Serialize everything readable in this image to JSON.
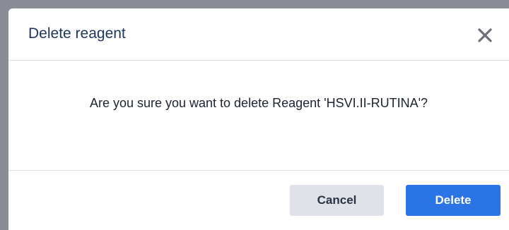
{
  "dialog": {
    "title": "Delete reagent",
    "message": "Are you sure you want to delete Reagent 'HSVI.II-RUTINA'?",
    "close_icon": "close-icon",
    "cancel_label": "Cancel",
    "delete_label": "Delete"
  },
  "colors": {
    "primary": "#2a74e6",
    "secondary": "#dfe3e9",
    "title": "#1f3559",
    "overlay": "#8a8d96"
  }
}
